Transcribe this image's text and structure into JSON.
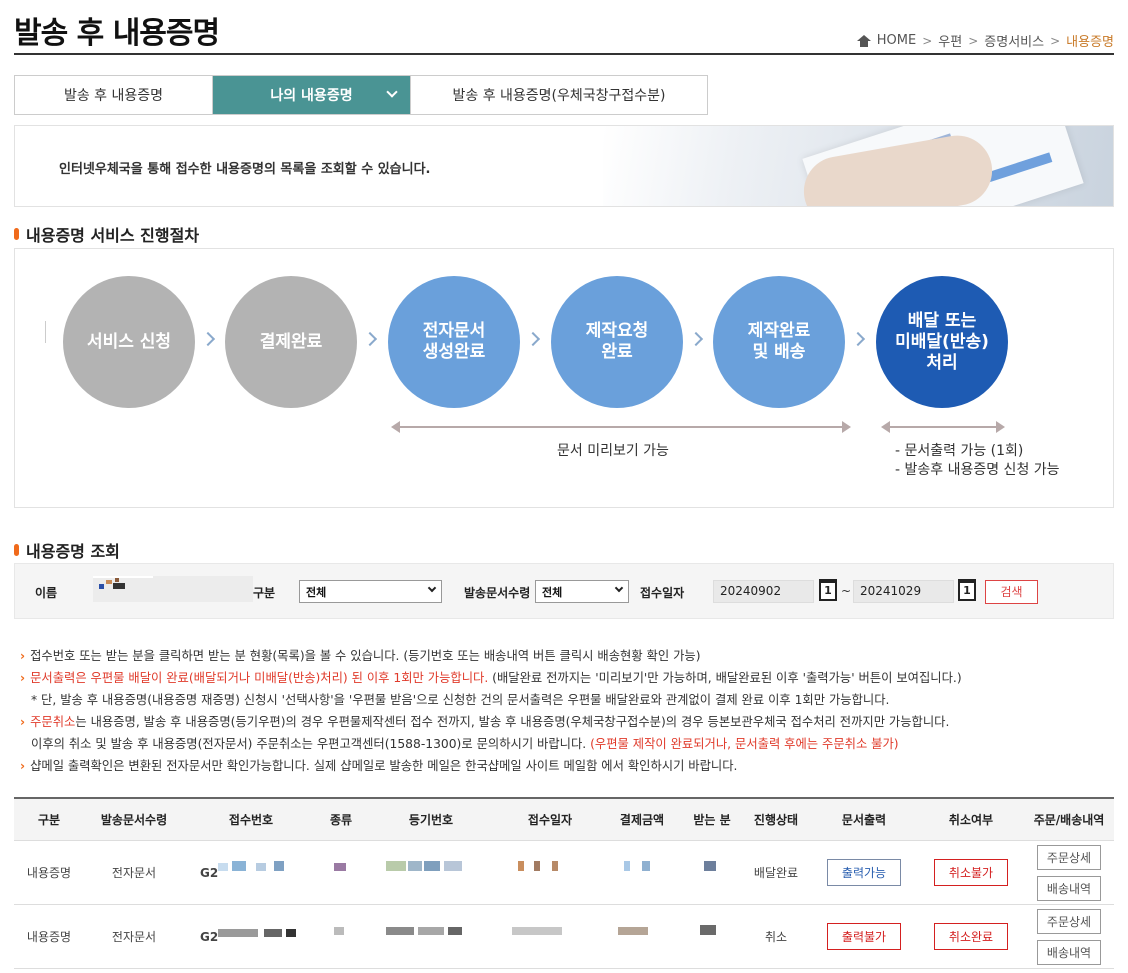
{
  "page": {
    "title": "발송 후 내용증명"
  },
  "breadcrumb": {
    "home": "HOME",
    "items": [
      "우편",
      "증명서비스"
    ],
    "current": "내용증명"
  },
  "tabs": [
    {
      "label": "발송 후 내용증명"
    },
    {
      "label": "나의 내용증명"
    },
    {
      "label": "발송 후 내용증명(우체국창구접수분)"
    }
  ],
  "banner": {
    "text": "인터넷우체국을 통해 접수한 내용증명의 목록을 조회할 수 있습니다."
  },
  "process": {
    "title": "내용증명 서비스 진행절차",
    "steps": [
      {
        "line1": "서비스 신청",
        "line2": "",
        "line3": ""
      },
      {
        "line1": "결제완료",
        "line2": "",
        "line3": ""
      },
      {
        "line1": "전자문서",
        "line2": "생성완료",
        "line3": ""
      },
      {
        "line1": "제작요청",
        "line2": "완료",
        "line3": ""
      },
      {
        "line1": "제작완료",
        "line2": "및 배송",
        "line3": ""
      },
      {
        "line1": "배달 또는",
        "line2": "미배달(반송)",
        "line3": "처리"
      }
    ],
    "preview_note": "문서 미리보기 가능",
    "after_notes": [
      "- 문서출력 가능 (1회)",
      "- 발송후 내용증명 신청 가능"
    ]
  },
  "search": {
    "title": "내용증명 조회",
    "name_label": "이름",
    "type_label": "구분",
    "type_value": "전체",
    "qty_label": "발송문서수령",
    "qty_value": "전체",
    "date_label": "접수일자",
    "date_from": "20240902",
    "date_to": "20241029",
    "tilde": "~",
    "calendar_glyph": "1",
    "button": "검색"
  },
  "notes": {
    "n1": "접수번호 또는 받는 분을 클릭하면 받는 분 현황(목록)을 볼 수 있습니다. (등기번호 또는 배송내역 버튼 클릭시 배송현황 확인 가능)",
    "n2_red": "문서출력은 우편물 배달이 완료(배달되거나 미배달(반송)처리) 된 이후 1회만 가능합니다.",
    "n2_rest": " (배달완료 전까지는 '미리보기'만 가능하며, 배달완료된 이후 '출력가능' 버튼이 보여집니다.)",
    "n3": "* 단, 발송 후 내용증명(내용증명 재증명) 신청시 '선택사항'을 '우편물 받음'으로 신청한 건의 문서출력은 우편물 배달완료와 관계없이 결제 완료 이후 1회만 가능합니다.",
    "n4_red": "주문취소",
    "n4_rest": "는 내용증명, 발송 후 내용증명(등기우편)의 경우 우편물제작센터 접수 전까지, 발송 후 내용증명(우체국창구접수분)의 경우 등본보관우체국 접수처리 전까지만 가능합니다.",
    "n5": "이후의 취소 및 발송 후 내용증명(전자문서) 주문취소는 우편고객센터(1588-1300)로 문의하시기 바랍니다. ",
    "n5_red": "(우편물 제작이 완료되거나, 문서출력 후에는 주문취소 불가)",
    "n6": "샵메일 출력확인은 변환된 전자문서만 확인가능합니다. 실제 샵메일로 발송한 메일은 한국샵메일 사이트 메일함 에서 확인하시기 바랍니다."
  },
  "table": {
    "headers": [
      "구분",
      "발송문서수령",
      "접수번호",
      "종류",
      "등기번호",
      "접수일자",
      "결제금액",
      "받는 분",
      "진행상태",
      "문서출력",
      "취소여부",
      "주문/배송내역"
    ],
    "rows": [
      {
        "type": "내용증명",
        "recv": "전자문서",
        "receipt_prefix": "G2",
        "status": "배달완료",
        "print": "출력가능",
        "cancel": "취소불가",
        "detail": "주문상세",
        "delivery": "배송내역"
      },
      {
        "type": "내용증명",
        "recv": "전자문서",
        "receipt_prefix": "G2",
        "status": "취소",
        "print": "출력불가",
        "cancel": "취소완료",
        "detail": "주문상세",
        "delivery": "배송내역"
      }
    ]
  },
  "colors": {
    "active_tab": "#4a9494",
    "step_gray": "#b3b3b3",
    "step_light": "#6aa0db",
    "step_dark": "#1e5bb3",
    "accent_orange": "#f06a1b",
    "alert_red": "#e03b2b"
  },
  "icons": [
    "home-icon",
    "chevron-down-icon",
    "arrow-right-icon",
    "calendar-icon"
  ]
}
